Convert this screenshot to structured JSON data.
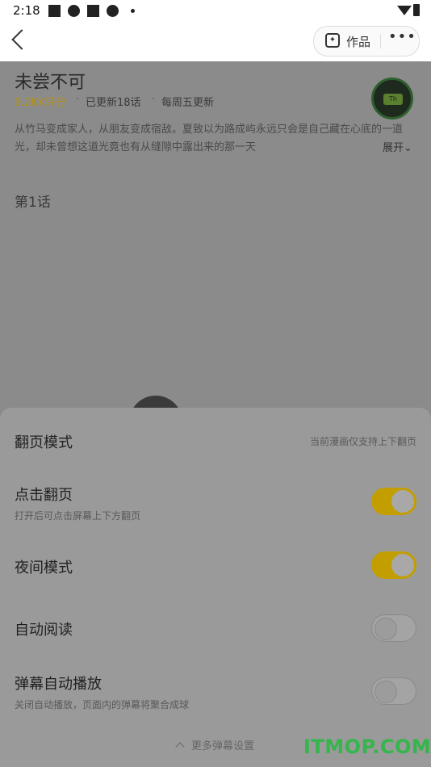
{
  "status_bar": {
    "time": "2:18"
  },
  "top_bar": {
    "works_label": "作品"
  },
  "comic": {
    "title": "未尝不可",
    "score": "9.2KK评分",
    "updated": "已更新18话",
    "schedule": "每周五更新",
    "separator": "·",
    "description": "从竹马变成家人，从朋友变成宿敌。夏致以为路成屿永远只会是自己藏在心底的一道光，却未曾想这道光竟也有从缝隙中露出来的那一天",
    "expand_label": "展开",
    "chapter_title": "第1话",
    "avatar_text": "Th"
  },
  "settings_sheet": {
    "page_mode": {
      "title": "翻页模式",
      "hint": "当前漫画仅支持上下翻页"
    },
    "tap_page": {
      "title": "点击翻页",
      "subtitle": "打开后可点击屏幕上下方翻页",
      "on": true
    },
    "night_mode": {
      "title": "夜间模式",
      "on": true
    },
    "auto_read": {
      "title": "自动阅读",
      "on": false
    },
    "danmaku_autoplay": {
      "title": "弹幕自动播放",
      "subtitle": "关闭自动播放，页面内的弹幕将聚合成球",
      "on": false
    },
    "more_danmaku_label": "更多弹幕设置"
  },
  "watermark": "ITMOP.COM",
  "colors": {
    "accent_yellow": "#c39e00",
    "watermark_green": "#33b64a"
  }
}
